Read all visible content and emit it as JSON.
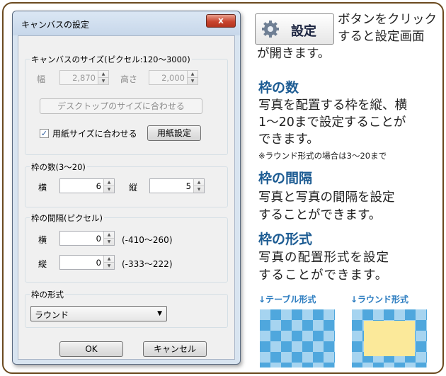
{
  "dialog": {
    "title": "キャンバスの設定",
    "close_glyph": "x",
    "canvas_size": {
      "label": "キャンバスのサイズ(ピクセル:120〜3000)",
      "width_label": "幅",
      "width_value": "2,870",
      "height_label": "高さ",
      "height_value": "2,000",
      "fit_desktop_button": "デスクトップのサイズに合わせる",
      "fit_paper_checkbox": "用紙サイズに合わせる",
      "fit_paper_checked": true,
      "paper_settings_button": "用紙設定"
    },
    "frame_count": {
      "label": "枠の数(3〜20)",
      "horizontal_label": "横",
      "horizontal_value": "6",
      "vertical_label": "縦",
      "vertical_value": "5"
    },
    "frame_spacing": {
      "label": "枠の間隔(ピクセル)",
      "horizontal_label": "横",
      "horizontal_value": "0",
      "horizontal_range": "(-410〜260)",
      "vertical_label": "縦",
      "vertical_value": "0",
      "vertical_range": "(-333〜222)"
    },
    "frame_style": {
      "label": "枠の形式",
      "selected": "ラウンド"
    },
    "ok_button": "OK",
    "cancel_button": "キャンセル"
  },
  "guide": {
    "settings_button_label": "設定",
    "intro_line1": "ボタンをクリック",
    "intro_line2": "すると設定画面",
    "intro_line3": "が開きます。",
    "count_heading": "枠の数",
    "count_line1": "写真を配置する枠を縦、横",
    "count_line2": "1〜20まで設定することが",
    "count_line3": "できます。",
    "count_note": "※ラウンド形式の場合は3〜20まで",
    "spacing_heading": "枠の間隔",
    "spacing_line1": "写真と写真の間隔を設定",
    "spacing_line2": "することができます。",
    "style_heading": "枠の形式",
    "style_line1": "写真の配置形式を設定",
    "style_line2": "することができます。",
    "table_caption": "↓テーブル形式",
    "round_caption": "↓ラウンド形式"
  },
  "colors": {
    "heading": "#1d5c93",
    "caption": "#2b7cc0",
    "frame_border": "#6b4a1f",
    "pattern_dark": "#4fa7dd",
    "pattern_light": "#a6d4f0",
    "round_center": "#fbe99a"
  },
  "icons": [
    "gear-icon",
    "close-icon",
    "spin-up-icon",
    "spin-down-icon",
    "dropdown-arrow-icon",
    "checkmark-icon"
  ]
}
